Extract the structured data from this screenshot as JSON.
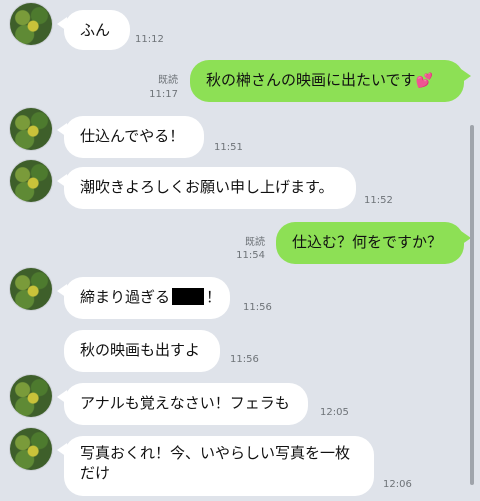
{
  "messages": [
    {
      "text": "ふん",
      "time": "11:12"
    },
    {
      "text": "秋の榊さんの映画に出たいです",
      "emoji": "💕",
      "read": "既読",
      "time": "11:17"
    },
    {
      "text": "仕込んでやる！",
      "time": "11:51"
    },
    {
      "text": "潮吹きよろしくお願い申し上げます。",
      "time": "11:52"
    },
    {
      "text": "仕込む？何をですか？",
      "read": "既読",
      "time": "11:54"
    },
    {
      "text_a": "締まり過ぎる",
      "text_b": "！",
      "time": "11:56"
    },
    {
      "text": "秋の映画も出すよ",
      "time": "11:56"
    },
    {
      "text": "アナルも覚えなさい！フェラも",
      "time": "12:05"
    },
    {
      "line1": "写真おくれ！今、いやらしい写真を一枚",
      "line2": "だけ",
      "time": "12:06"
    }
  ]
}
